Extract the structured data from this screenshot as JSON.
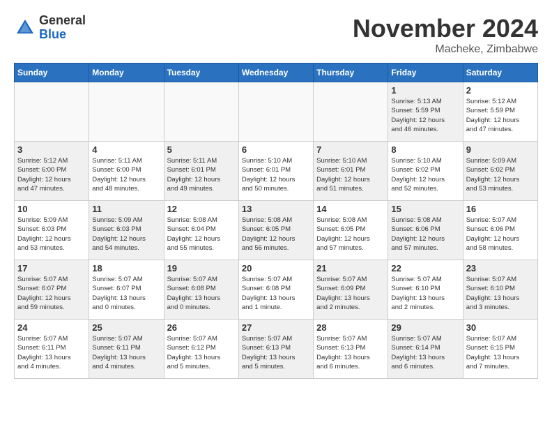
{
  "header": {
    "logo_general": "General",
    "logo_blue": "Blue",
    "month_title": "November 2024",
    "location": "Macheke, Zimbabwe"
  },
  "weekdays": [
    "Sunday",
    "Monday",
    "Tuesday",
    "Wednesday",
    "Thursday",
    "Friday",
    "Saturday"
  ],
  "weeks": [
    [
      {
        "day": "",
        "info": "",
        "empty": true
      },
      {
        "day": "",
        "info": "",
        "empty": true
      },
      {
        "day": "",
        "info": "",
        "empty": true
      },
      {
        "day": "",
        "info": "",
        "empty": true
      },
      {
        "day": "",
        "info": "",
        "empty": true
      },
      {
        "day": "1",
        "info": "Sunrise: 5:13 AM\nSunset: 5:59 PM\nDaylight: 12 hours\nand 46 minutes.",
        "shaded": true
      },
      {
        "day": "2",
        "info": "Sunrise: 5:12 AM\nSunset: 5:59 PM\nDaylight: 12 hours\nand 47 minutes."
      }
    ],
    [
      {
        "day": "3",
        "info": "Sunrise: 5:12 AM\nSunset: 6:00 PM\nDaylight: 12 hours\nand 47 minutes.",
        "shaded": true
      },
      {
        "day": "4",
        "info": "Sunrise: 5:11 AM\nSunset: 6:00 PM\nDaylight: 12 hours\nand 48 minutes."
      },
      {
        "day": "5",
        "info": "Sunrise: 5:11 AM\nSunset: 6:01 PM\nDaylight: 12 hours\nand 49 minutes.",
        "shaded": true
      },
      {
        "day": "6",
        "info": "Sunrise: 5:10 AM\nSunset: 6:01 PM\nDaylight: 12 hours\nand 50 minutes."
      },
      {
        "day": "7",
        "info": "Sunrise: 5:10 AM\nSunset: 6:01 PM\nDaylight: 12 hours\nand 51 minutes.",
        "shaded": true
      },
      {
        "day": "8",
        "info": "Sunrise: 5:10 AM\nSunset: 6:02 PM\nDaylight: 12 hours\nand 52 minutes."
      },
      {
        "day": "9",
        "info": "Sunrise: 5:09 AM\nSunset: 6:02 PM\nDaylight: 12 hours\nand 53 minutes.",
        "shaded": true
      }
    ],
    [
      {
        "day": "10",
        "info": "Sunrise: 5:09 AM\nSunset: 6:03 PM\nDaylight: 12 hours\nand 53 minutes."
      },
      {
        "day": "11",
        "info": "Sunrise: 5:09 AM\nSunset: 6:03 PM\nDaylight: 12 hours\nand 54 minutes.",
        "shaded": true
      },
      {
        "day": "12",
        "info": "Sunrise: 5:08 AM\nSunset: 6:04 PM\nDaylight: 12 hours\nand 55 minutes."
      },
      {
        "day": "13",
        "info": "Sunrise: 5:08 AM\nSunset: 6:05 PM\nDaylight: 12 hours\nand 56 minutes.",
        "shaded": true
      },
      {
        "day": "14",
        "info": "Sunrise: 5:08 AM\nSunset: 6:05 PM\nDaylight: 12 hours\nand 57 minutes."
      },
      {
        "day": "15",
        "info": "Sunrise: 5:08 AM\nSunset: 6:06 PM\nDaylight: 12 hours\nand 57 minutes.",
        "shaded": true
      },
      {
        "day": "16",
        "info": "Sunrise: 5:07 AM\nSunset: 6:06 PM\nDaylight: 12 hours\nand 58 minutes."
      }
    ],
    [
      {
        "day": "17",
        "info": "Sunrise: 5:07 AM\nSunset: 6:07 PM\nDaylight: 12 hours\nand 59 minutes.",
        "shaded": true
      },
      {
        "day": "18",
        "info": "Sunrise: 5:07 AM\nSunset: 6:07 PM\nDaylight: 13 hours\nand 0 minutes."
      },
      {
        "day": "19",
        "info": "Sunrise: 5:07 AM\nSunset: 6:08 PM\nDaylight: 13 hours\nand 0 minutes.",
        "shaded": true
      },
      {
        "day": "20",
        "info": "Sunrise: 5:07 AM\nSunset: 6:08 PM\nDaylight: 13 hours\nand 1 minute."
      },
      {
        "day": "21",
        "info": "Sunrise: 5:07 AM\nSunset: 6:09 PM\nDaylight: 13 hours\nand 2 minutes.",
        "shaded": true
      },
      {
        "day": "22",
        "info": "Sunrise: 5:07 AM\nSunset: 6:10 PM\nDaylight: 13 hours\nand 2 minutes."
      },
      {
        "day": "23",
        "info": "Sunrise: 5:07 AM\nSunset: 6:10 PM\nDaylight: 13 hours\nand 3 minutes.",
        "shaded": true
      }
    ],
    [
      {
        "day": "24",
        "info": "Sunrise: 5:07 AM\nSunset: 6:11 PM\nDaylight: 13 hours\nand 4 minutes."
      },
      {
        "day": "25",
        "info": "Sunrise: 5:07 AM\nSunset: 6:11 PM\nDaylight: 13 hours\nand 4 minutes.",
        "shaded": true
      },
      {
        "day": "26",
        "info": "Sunrise: 5:07 AM\nSunset: 6:12 PM\nDaylight: 13 hours\nand 5 minutes."
      },
      {
        "day": "27",
        "info": "Sunrise: 5:07 AM\nSunset: 6:13 PM\nDaylight: 13 hours\nand 5 minutes.",
        "shaded": true
      },
      {
        "day": "28",
        "info": "Sunrise: 5:07 AM\nSunset: 6:13 PM\nDaylight: 13 hours\nand 6 minutes."
      },
      {
        "day": "29",
        "info": "Sunrise: 5:07 AM\nSunset: 6:14 PM\nDaylight: 13 hours\nand 6 minutes.",
        "shaded": true
      },
      {
        "day": "30",
        "info": "Sunrise: 5:07 AM\nSunset: 6:15 PM\nDaylight: 13 hours\nand 7 minutes."
      }
    ]
  ]
}
